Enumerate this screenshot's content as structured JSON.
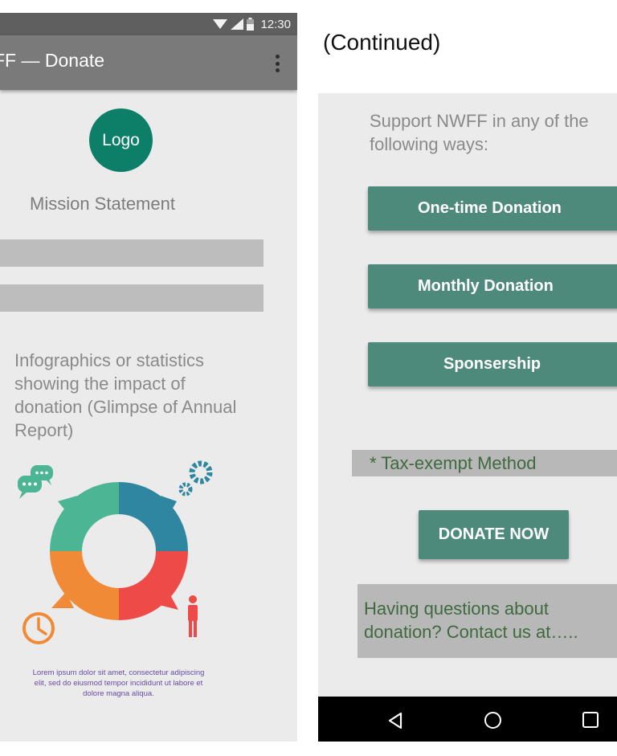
{
  "status_bar": {
    "time": "12:30"
  },
  "app_bar": {
    "title": "FF — Donate"
  },
  "logo": {
    "label": "Logo",
    "color": "#0d7f68"
  },
  "mission_statement": "Mission Statement",
  "infographic_caption": "Infographics or statistics showing the impact of donation (Glimpse of Annual Report)",
  "lorem": "Lorem ipsum dolor sit amet, consectetur adipiscing elit, sed do eiusmod tempor incididunt ut labore et dolore magna aliqua.",
  "continued_label": "(Continued)",
  "support_text": "Support NWFF in any of the following ways:",
  "buttons": {
    "one_time": "One-time Donation",
    "monthly": "Monthly Donation",
    "sponsorship": "Sponsership",
    "donate_now": "DONATE NOW"
  },
  "tax_note": "* Tax-exempt Method",
  "contact_text": "Having questions about donation? Contact us at…..",
  "colors": {
    "primary_button": "#4e8a7c",
    "ring_teal": "#4cb594",
    "ring_blue": "#2e86a1",
    "ring_red": "#ee4b48",
    "ring_orange": "#f08a36"
  }
}
